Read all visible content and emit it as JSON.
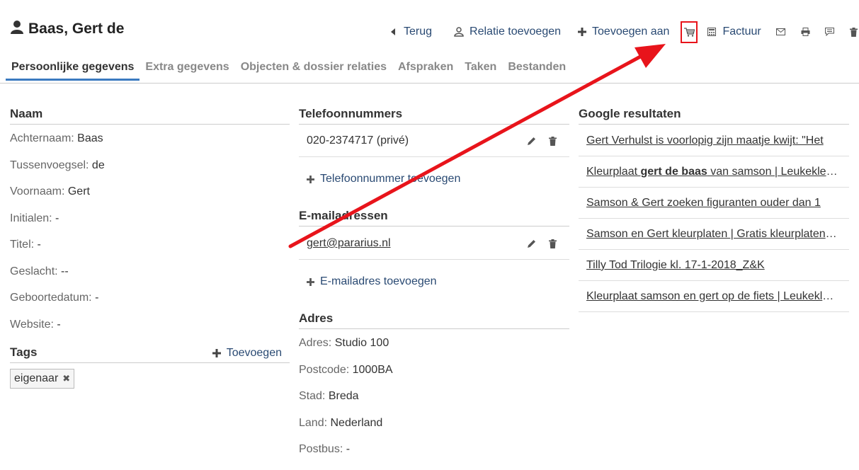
{
  "header": {
    "title": "Baas, Gert de",
    "actions": {
      "back": "Terug",
      "add_relation": "Relatie toevoegen",
      "add_to": "Toevoegen aan",
      "invoice": "Factuur"
    }
  },
  "tabs": [
    {
      "label": "Persoonlijke gegevens"
    },
    {
      "label": "Extra gegevens"
    },
    {
      "label": "Objecten & dossier relaties"
    },
    {
      "label": "Afspraken"
    },
    {
      "label": "Taken"
    },
    {
      "label": "Bestanden"
    }
  ],
  "naam": {
    "heading": "Naam",
    "fields": [
      {
        "label": "Achternaam:",
        "value": "Baas"
      },
      {
        "label": "Tussenvoegsel:",
        "value": "de"
      },
      {
        "label": "Voornaam:",
        "value": "Gert"
      },
      {
        "label": "Initialen:",
        "value": "-"
      },
      {
        "label": "Titel:",
        "value": "-"
      },
      {
        "label": "Geslacht:",
        "value": "--"
      },
      {
        "label": "Geboortedatum:",
        "value": "-"
      },
      {
        "label": "Website:",
        "value": "-"
      }
    ]
  },
  "tags": {
    "heading": "Tags",
    "add_label": "Toevoegen",
    "items": [
      "eigenaar"
    ]
  },
  "phones": {
    "heading": "Telefoonnummers",
    "items": [
      "020-2374717 (privé)"
    ],
    "add_label": "Telefoonnummer toevoegen"
  },
  "emails": {
    "heading": "E-mailadressen",
    "items": [
      "gert@pararius.nl"
    ],
    "add_label": "E-mailadres toevoegen"
  },
  "adres": {
    "heading": "Adres",
    "fields": [
      {
        "label": "Adres:",
        "value": "Studio 100"
      },
      {
        "label": "Postcode:",
        "value": "1000BA"
      },
      {
        "label": "Stad:",
        "value": "Breda"
      },
      {
        "label": "Land:",
        "value": "Nederland"
      },
      {
        "label": "Postbus:",
        "value": "-"
      }
    ]
  },
  "google": {
    "heading": "Google resultaten",
    "results": [
      {
        "pre": "Gert Verhulst is voorlopig zijn maatje kwijt: \"Het",
        "bold": "",
        "post": ""
      },
      {
        "pre": "Kleurplaat ",
        "bold": "gert de baas",
        "post": " van samson | Leukekleurplaten.nl"
      },
      {
        "pre": "Samson & Gert zoeken figuranten ouder dan 1",
        "bold": "",
        "post": ""
      },
      {
        "pre": "Samson en Gert kleurplaten | Gratis kleurplaten printen",
        "bold": "",
        "post": ""
      },
      {
        "pre": "Tilly Tod Trilogie kl. 17-1-2018_Z&K",
        "bold": "",
        "post": ""
      },
      {
        "pre": "Kleurplaat samson en gert op de fiets | Leukekleurplaten",
        "bold": "",
        "post": ""
      }
    ]
  },
  "colors": {
    "link": "#2a4a73",
    "tab_active": "#3b7ac0",
    "annotation": "#e8141b"
  }
}
